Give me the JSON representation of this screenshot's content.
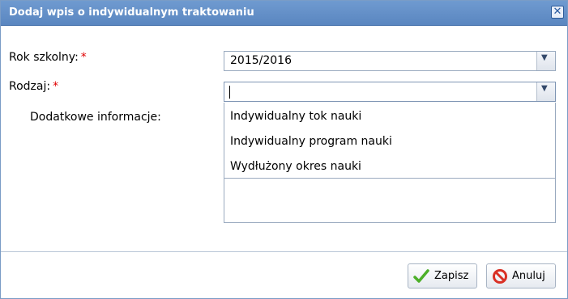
{
  "dialog": {
    "title": "Dodaj wpis o indywidualnym traktowaniu",
    "close_icon": "close-icon"
  },
  "form": {
    "school_year_label": "Rok szkolny:",
    "school_year_value": "2015/2016",
    "type_label": "Rodzaj:",
    "type_value": "",
    "additional_info_label": "Dodatkowe informacje:",
    "required_marker": "*"
  },
  "type_options": [
    "Indywidualny tok nauki",
    "Indywidualny program nauki",
    "Wydłużony okres nauki"
  ],
  "buttons": {
    "save_label": "Zapisz",
    "cancel_label": "Anuluj"
  },
  "colors": {
    "title_bar": "#5f8ac4",
    "required": "#e00000",
    "save_icon": "#4caf28",
    "cancel_icon": "#d93025"
  }
}
